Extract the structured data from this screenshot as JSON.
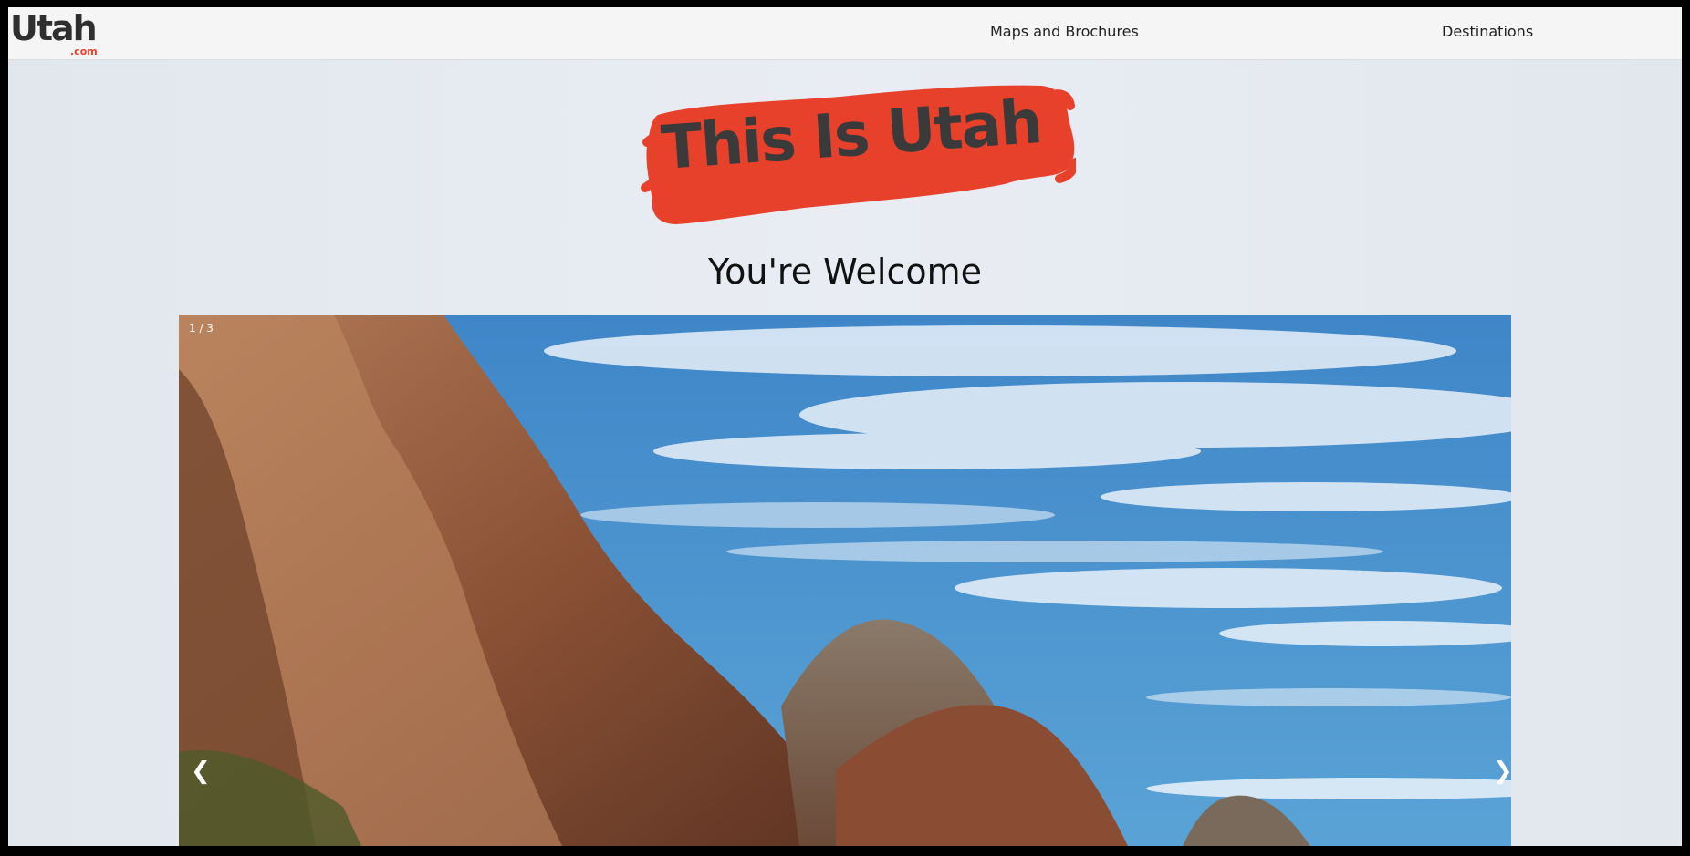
{
  "logo": {
    "main": "Utah",
    "sub": ".com"
  },
  "nav": {
    "items": [
      {
        "label": "Maps and Brochures"
      },
      {
        "label": "Destinations"
      }
    ]
  },
  "hero": {
    "title": "This Is Utah",
    "subtitle": "You're Welcome"
  },
  "slideshow": {
    "counter": "1 / 3",
    "prev_icon": "❮",
    "next_icon": "❯",
    "current_slide": 1,
    "total_slides": 3
  },
  "colors": {
    "accent": "#e8412b",
    "nav_background": "#f5f5f5",
    "page_background": "#e6ebf1",
    "text_dark": "#3a3a3a"
  }
}
